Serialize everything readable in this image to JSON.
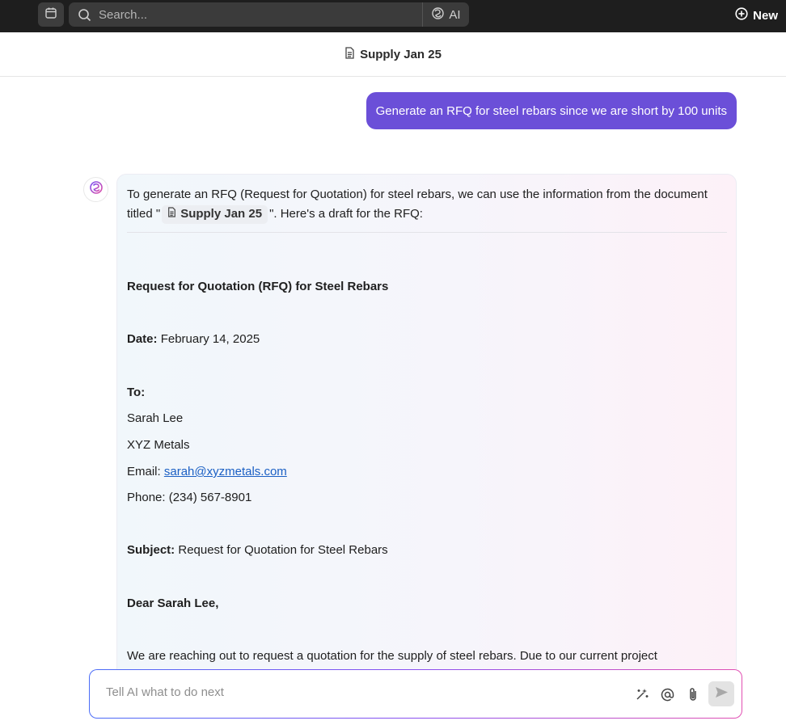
{
  "topbar": {
    "search_placeholder": "Search...",
    "ai_label": "AI",
    "new_label": "New"
  },
  "doc_header": {
    "title": "Supply Jan 25"
  },
  "user_message": "Generate an RFQ for steel rebars since we are short by 100 units",
  "ai_response": {
    "intro_part1": "To generate an RFQ (Request for Quotation) for steel rebars, we can use the information from the document titled \"",
    "doc_chip": "Supply Jan 25",
    "intro_part2": "\". Here's a draft for the RFQ:",
    "heading": "Request for Quotation (RFQ) for Steel Rebars",
    "date_label": "Date:",
    "date_value": "February 14, 2025",
    "to_label": "To:",
    "to_name": "Sarah Lee",
    "to_company": "XYZ Metals",
    "email_label": "Email:",
    "email_value": "sarah@xyzmetals.com",
    "phone": "Phone: (234) 567-8901",
    "subject_label": "Subject:",
    "subject_value": "Request for Quotation for Steel Rebars",
    "greeting": "Dear Sarah Lee,",
    "body_start": "We are reaching out to request a quotation for the supply of steel rebars. Due to our current project"
  },
  "input": {
    "placeholder": "Tell AI what to do next"
  },
  "icons": {
    "calendar": "calendar-icon",
    "search": "search-icon",
    "ai": "ai-logo-icon",
    "new": "plus-circle-icon",
    "document": "document-icon",
    "magic": "magic-wand-icon",
    "mention": "at-sign-icon",
    "attach": "paperclip-icon",
    "send": "send-icon"
  },
  "colors": {
    "topbar": "#1e1e1e",
    "user_bubble": "#6b4fd8",
    "link": "#1a5fc4"
  }
}
